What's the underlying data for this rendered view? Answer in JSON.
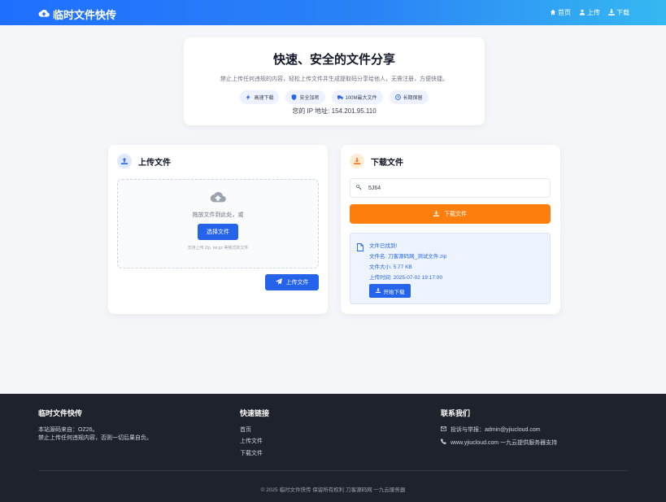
{
  "header": {
    "brand": "临时文件快传",
    "nav": [
      "首页",
      "上传",
      "下载"
    ]
  },
  "hero": {
    "title": "快速、安全的文件分享",
    "subtitle": "禁止上传任何违规的内容，轻松上传文件并生成提取码分享给他人，无需注册，方便快捷。",
    "badges": [
      "高速下载",
      "安全加密",
      "100M最大文件",
      "长期保留"
    ],
    "ip_label": "您的 IP 地址:",
    "ip_value": "154.201.95.110"
  },
  "upload": {
    "title": "上传文件",
    "drop_text": "拖放文件到此处，或",
    "choose_label": "选择文件",
    "hint": "支持上传 Zip, tar.gz 等格式的文件",
    "upload_label": "上传文件"
  },
  "download": {
    "title": "下载文件",
    "code_value": "5J64",
    "download_label": "下载文件",
    "info_title": "文件已找到!",
    "filename_label": "文件名:",
    "filename_value": "刀客源码网_测试文件.zip",
    "size_label": "文件大小:",
    "size_value": "5.77 KB",
    "time_label": "上传时间:",
    "time_value": "2025-07-02 19:17:00",
    "start_label": "开始下载"
  },
  "footer": {
    "col1_title": "临时文件快传",
    "col1_line1": "本站源码来自：OZ26。",
    "col1_line2": "禁止上传任何违规内容，否则一切后果自负。",
    "col2_title": "快速链接",
    "links": [
      "首页",
      "上传文件",
      "下载文件"
    ],
    "col3_title": "联系我们",
    "contact_email": "投诉与举报：admin@yjiucloud.com",
    "contact_site": "www.yjiucloud.com 一九云提供服务器支持",
    "copyright": "© 2025 临时文件快传 保留所有权利  刀客源码网  一九云服务器"
  },
  "colors": {
    "primary": "#2563eb",
    "accent": "#ff7f0e",
    "footer_bg": "#1e222b"
  }
}
